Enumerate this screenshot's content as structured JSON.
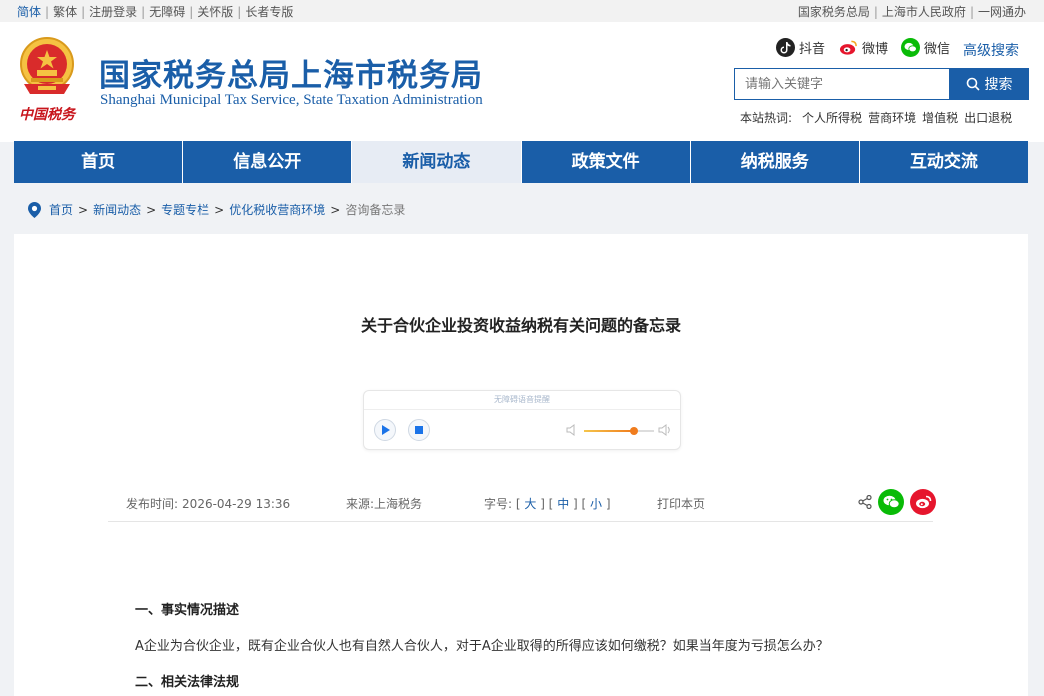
{
  "topbar": {
    "left": [
      "简体",
      "繁体",
      "注册登录",
      "无障碍",
      "关怀版",
      "长者专版"
    ],
    "right": [
      "国家税务总局",
      "上海市人民政府",
      "一网通办"
    ]
  },
  "header": {
    "slogan": "中国税务",
    "title": "国家税务总局上海市税务局",
    "subtitle": "Shanghai Municipal Tax Service, State Taxation Administration",
    "social": {
      "douyin": "抖音",
      "weibo": "微博",
      "wechat": "微信"
    },
    "advanced_search": "高级搜索",
    "search_placeholder": "请输入关键字",
    "search_button": "搜索",
    "hot_label": "本站热词:",
    "hot_words": [
      "个人所得税",
      "营商环境",
      "增值税",
      "出口退税"
    ]
  },
  "nav": [
    "首页",
    "信息公开",
    "新闻动态",
    "政策文件",
    "纳税服务",
    "互动交流"
  ],
  "breadcrumb": {
    "items": [
      "首页",
      "新闻动态",
      "专题专栏",
      "优化税收营商环境"
    ],
    "current": "咨询备忘录"
  },
  "article": {
    "title": "关于合伙企业投资收益纳税有关问题的备忘录",
    "player_label": "无障碍语音提醒",
    "player_volume": 0.72,
    "publish_label": "发布时间:",
    "publish_time": "2026-04-29 13:36",
    "source_label": "来源:",
    "source": "上海税务",
    "size_label": "字号:",
    "size_large": "大",
    "size_medium": "中",
    "size_small": "小",
    "print": "打印本页",
    "section1": "一、事实情况描述",
    "para1": "A企业为合伙企业，既有企业合伙人也有自然人合伙人，对于A企业取得的所得应该如何缴税？如果当年度为亏损怎么办？",
    "section2": "二、相关法律法规"
  },
  "colors": {
    "brand": "#1a5ea8",
    "accent": "#f07c1d",
    "wechat": "#09bb07",
    "weibo": "#e6162d"
  }
}
